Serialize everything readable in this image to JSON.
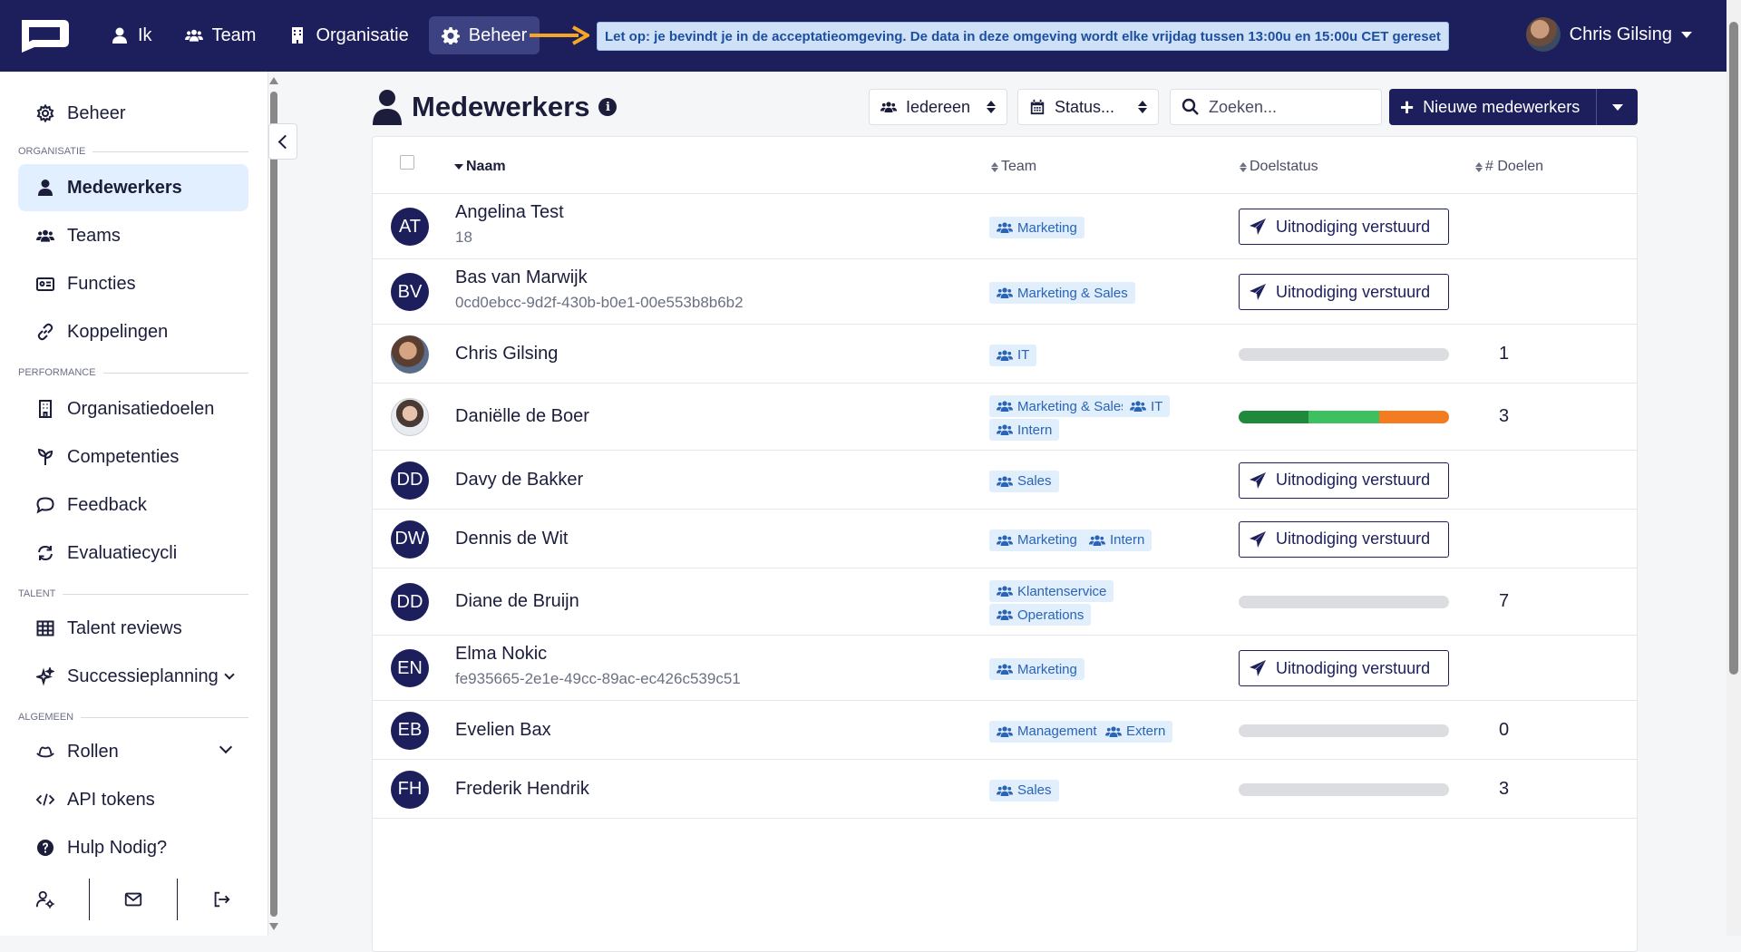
{
  "topbar": {
    "nav": [
      {
        "label": "Ik",
        "icon": "user-icon"
      },
      {
        "label": "Team",
        "icon": "users-icon"
      },
      {
        "label": "Organisatie",
        "icon": "building-icon"
      },
      {
        "label": "Beheer",
        "icon": "gear-icon",
        "active": true
      }
    ],
    "banner": "Let op: je bevindt je in de acceptatieomgeving. De data in deze omgeving wordt elke vrijdag tussen 13:00u en 15:00u CET gereset",
    "user_name": "Chris Gilsing"
  },
  "sidebar": {
    "top_item": "Beheer",
    "sections": {
      "organisatie": "ORGANISATIE",
      "performance": "PERFORMANCE",
      "talent": "TALENT",
      "algemeen": "ALGEMEEN"
    },
    "items": {
      "medewerkers": "Medewerkers",
      "teams": "Teams",
      "functies": "Functies",
      "koppelingen": "Koppelingen",
      "organisatiedoelen": "Organisatiedoelen",
      "competenties": "Competenties",
      "feedback": "Feedback",
      "evaluatiecycli": "Evaluatiecycli",
      "talent_reviews": "Talent reviews",
      "successieplanning": "Successieplanning",
      "rollen": "Rollen",
      "api_tokens": "API tokens",
      "hulp": "Hulp Nodig?"
    }
  },
  "page": {
    "title": "Medewerkers",
    "filter_people": "Iedereen",
    "filter_status": "Status...",
    "search_placeholder": "Zoeken...",
    "new_button": "Nieuwe medewerkers"
  },
  "table": {
    "headers": {
      "name": "Naam",
      "team": "Team",
      "status": "Doelstatus",
      "goals": "# Doelen"
    },
    "invite_label": "Uitnodiging verstuurd",
    "rows": [
      {
        "initials": "AT",
        "name": "Angelina Test",
        "sub": "18",
        "teams": [
          "Marketing"
        ],
        "status": "invite",
        "goals": ""
      },
      {
        "initials": "BV",
        "name": "Bas van Marwijk",
        "sub": "0cd0ebcc-9d2f-430b-b0e1-00e553b8b6b2",
        "teams": [
          "Marketing & Sales"
        ],
        "status": "invite",
        "goals": ""
      },
      {
        "initials": "",
        "name": "Chris Gilsing",
        "sub": "",
        "teams": [
          "IT"
        ],
        "status": "bar",
        "goals": "1"
      },
      {
        "initials": "",
        "name": "Daniëlle de Boer",
        "sub": "",
        "teams": [
          "Marketing & Sales",
          "IT",
          "Intern"
        ],
        "status": "bar",
        "goals": "3",
        "progress": [
          {
            "color": "#1f8a3c",
            "fraction": 0.333
          },
          {
            "color": "#3cc060",
            "fraction": 0.333
          },
          {
            "color": "#f47c20",
            "fraction": 0.334
          }
        ]
      },
      {
        "initials": "DD",
        "name": "Davy de Bakker",
        "sub": "",
        "teams": [
          "Sales"
        ],
        "status": "invite",
        "goals": ""
      },
      {
        "initials": "DW",
        "name": "Dennis de Wit",
        "sub": "",
        "teams": [
          "Marketing",
          "Intern"
        ],
        "status": "invite",
        "goals": ""
      },
      {
        "initials": "DD",
        "name": "Diane de Bruijn",
        "sub": "",
        "teams": [
          "Klantenservice",
          "Operations"
        ],
        "status": "bar",
        "goals": "7"
      },
      {
        "initials": "EN",
        "name": "Elma Nokic",
        "sub": "fe935665-2e1e-49cc-89ac-ec426c539c51",
        "teams": [
          "Marketing"
        ],
        "status": "invite",
        "goals": ""
      },
      {
        "initials": "EB",
        "name": "Evelien Bax",
        "sub": "",
        "teams": [
          "Management",
          "Extern"
        ],
        "status": "bar",
        "goals": "0"
      },
      {
        "initials": "FH",
        "name": "Frederik Hendrik",
        "sub": "",
        "teams": [
          "Sales"
        ],
        "status": "bar",
        "goals": "3"
      }
    ]
  },
  "colors": {
    "navy": "#1c1f5c",
    "tag_bg": "#e1eefb",
    "tag_text": "#2a64b8",
    "accent_arrow": "#f5a623"
  }
}
